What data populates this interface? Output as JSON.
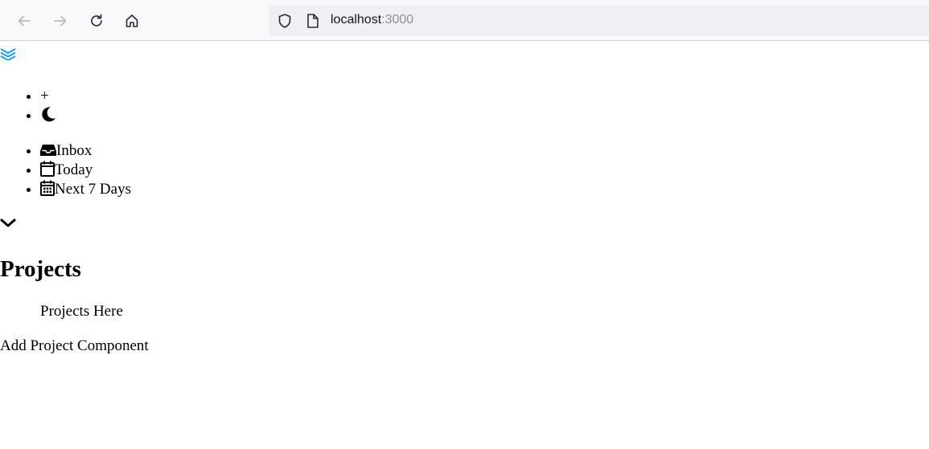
{
  "browser": {
    "url_host": "localhost",
    "url_port": ":3000",
    "icons": [
      "back-icon",
      "forward-icon",
      "reload-icon",
      "home-icon",
      "shield-icon",
      "page-icon"
    ]
  },
  "app": {
    "logo_icon": "layers-icon",
    "logo_color": "#1da1f2",
    "top_actions": [
      {
        "label": "+",
        "icon": "plus"
      },
      {
        "label": "",
        "icon": "moon-icon"
      }
    ],
    "filters": [
      {
        "label": "Inbox",
        "icon": "inbox-icon"
      },
      {
        "label": "Today",
        "icon": "calendar-icon"
      },
      {
        "label": "Next 7 Days",
        "icon": "calendar-grid-icon"
      }
    ],
    "projects_toggle_icon": "chevron-down-icon",
    "projects_title": "Projects",
    "projects_placeholder": "Projects Here",
    "add_project_label": "Add Project Component"
  }
}
